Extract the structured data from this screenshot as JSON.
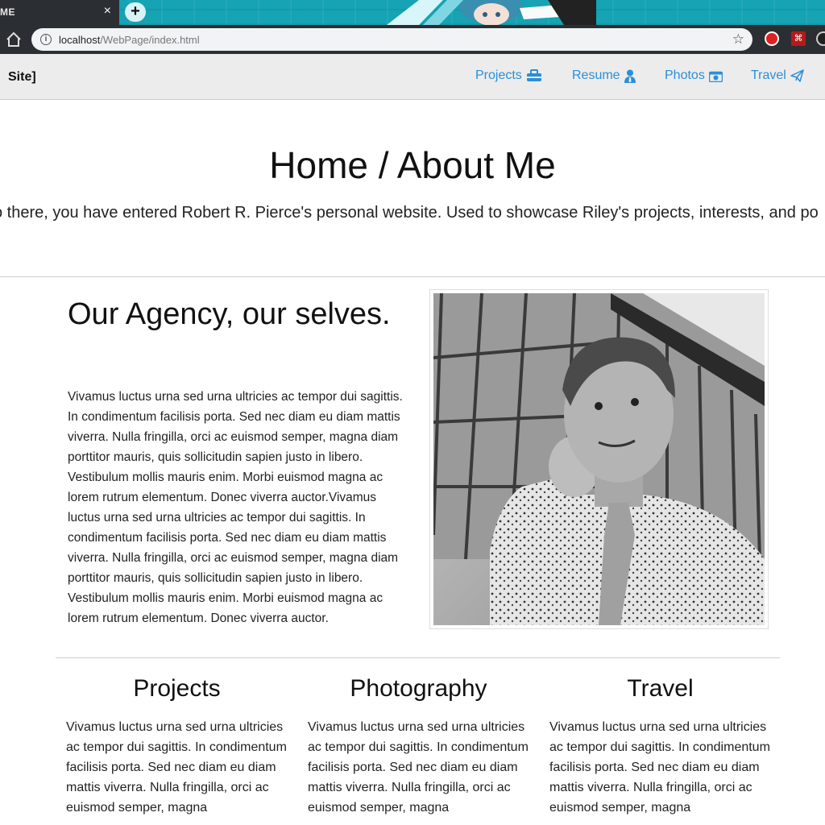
{
  "browser": {
    "tab_title": "ME",
    "tab_close": "×",
    "new_tab": "+",
    "url_host": "localhost",
    "url_path": "/WebPage/index.html",
    "extensions": [
      "ublock-icon",
      "pdf-icon",
      "extension-icon"
    ]
  },
  "navbar": {
    "brand": "Site]",
    "items": [
      {
        "label": "Projects",
        "icon": "toolbox-icon"
      },
      {
        "label": "Resume",
        "icon": "user-tie-icon"
      },
      {
        "label": "Photos",
        "icon": "camera-icon"
      },
      {
        "label": "Travel",
        "icon": "paper-plane-icon"
      }
    ],
    "link_color": "#2a8fd8"
  },
  "hero": {
    "title": "Home / About Me",
    "subtitle": "o there, you have entered Robert R. Pierce's personal website. Used to showcase Riley's projects, interests, and po"
  },
  "about": {
    "title": "Our Agency, our selves.",
    "body": "Vivamus luctus urna sed urna ultricies ac tempor dui sagittis. In condimentum facilisis porta. Sed nec diam eu diam mattis viverra. Nulla fringilla, orci ac euismod semper, magna diam porttitor mauris, quis sollicitudin sapien justo in libero. Vestibulum mollis mauris enim. Morbi euismod magna ac lorem rutrum elementum. Donec viverra auctor.Vivamus luctus urna sed urna ultricies ac tempor dui sagittis. In condimentum facilisis porta. Sed nec diam eu diam mattis viverra. Nulla fringilla, orci ac euismod semper, magna diam porttitor mauris, quis sollicitudin sapien justo in libero. Vestibulum mollis mauris enim. Morbi euismod magna ac lorem rutrum elementum. Donec viverra auctor."
  },
  "columns": [
    {
      "title": "Projects",
      "body": "Vivamus luctus urna sed urna ultricies ac tempor dui sagittis. In condimentum facilisis porta. Sed nec diam eu diam mattis viverra. Nulla fringilla, orci ac euismod semper, magna"
    },
    {
      "title": "Photography",
      "body": "Vivamus luctus urna sed urna ultricies ac tempor dui sagittis. In condimentum facilisis porta. Sed nec diam eu diam mattis viverra. Nulla fringilla, orci ac euismod semper, magna"
    },
    {
      "title": "Travel",
      "body": "Vivamus luctus urna sed urna ultricies ac tempor dui sagittis. In condimentum facilisis porta. Sed nec diam eu diam mattis viverra. Nulla fringilla, orci ac euismod semper, magna"
    }
  ]
}
